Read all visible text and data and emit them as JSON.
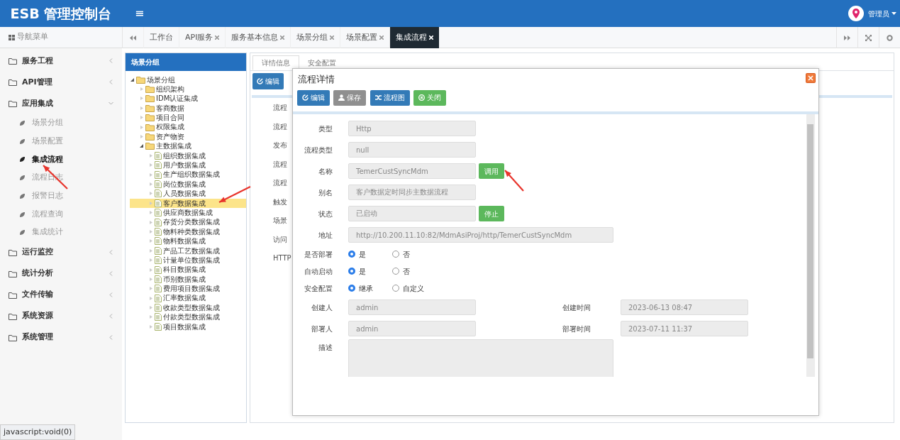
{
  "app": {
    "title": "ESB 管理控制台",
    "menu_toggle": "≡",
    "user": "管理员"
  },
  "nav_label": "导航菜单",
  "tabs": [
    {
      "label": "工作台",
      "closable": false,
      "selected": false
    },
    {
      "label": "API服务",
      "closable": true,
      "selected": false
    },
    {
      "label": "服务基本信息",
      "closable": true,
      "selected": false
    },
    {
      "label": "场景分组",
      "closable": true,
      "selected": false
    },
    {
      "label": "场景配置",
      "closable": true,
      "selected": false
    },
    {
      "label": "集成流程",
      "closable": true,
      "selected": true
    }
  ],
  "sidebar": {
    "items": [
      {
        "label": "服务工程",
        "expanded": false
      },
      {
        "label": "API管理",
        "expanded": false
      },
      {
        "label": "应用集成",
        "expanded": true,
        "children": [
          {
            "label": "场景分组",
            "selected": false
          },
          {
            "label": "场景配置",
            "selected": false
          },
          {
            "label": "集成流程",
            "selected": true
          },
          {
            "label": "流程日志",
            "selected": false
          },
          {
            "label": "报警日志",
            "selected": false
          },
          {
            "label": "流程查询",
            "selected": false
          },
          {
            "label": "集成统计",
            "selected": false
          }
        ]
      },
      {
        "label": "运行监控",
        "expanded": false
      },
      {
        "label": "统计分析",
        "expanded": false
      },
      {
        "label": "文件传输",
        "expanded": false
      },
      {
        "label": "系统资源",
        "expanded": false
      },
      {
        "label": "系统管理",
        "expanded": false
      }
    ]
  },
  "tree": {
    "title": "场景分组",
    "items": [
      {
        "label": "场景分组",
        "kind": "folder",
        "expanded": true,
        "selected": false,
        "children": [
          {
            "label": "组织架构",
            "kind": "folder",
            "expanded": false,
            "selected": false
          },
          {
            "label": "IDM认证集成",
            "kind": "folder",
            "expanded": false,
            "selected": false
          },
          {
            "label": "客商数据",
            "kind": "folder",
            "expanded": false,
            "selected": false
          },
          {
            "label": "项目合同",
            "kind": "folder",
            "expanded": false,
            "selected": false
          },
          {
            "label": "权限集成",
            "kind": "folder",
            "expanded": false,
            "selected": false
          },
          {
            "label": "资产物资",
            "kind": "folder",
            "expanded": false,
            "selected": false
          },
          {
            "label": "主数据集成",
            "kind": "folder",
            "expanded": true,
            "selected": false,
            "children": [
              {
                "label": "组织数据集成",
                "kind": "file",
                "expanded": false,
                "selected": false
              },
              {
                "label": "用户数据集成",
                "kind": "file",
                "expanded": false,
                "selected": false
              },
              {
                "label": "生产组织数据集成",
                "kind": "file",
                "expanded": false,
                "selected": false
              },
              {
                "label": "岗位数据集成",
                "kind": "file",
                "expanded": false,
                "selected": false
              },
              {
                "label": "人员数据集成",
                "kind": "file",
                "expanded": false,
                "selected": false
              },
              {
                "label": "客户数据集成",
                "kind": "file",
                "expanded": false,
                "selected": true
              },
              {
                "label": "供应商数据集成",
                "kind": "file",
                "expanded": false,
                "selected": false
              },
              {
                "label": "存货分类数据集成",
                "kind": "file",
                "expanded": false,
                "selected": false
              },
              {
                "label": "物料种类数据集成",
                "kind": "file",
                "expanded": false,
                "selected": false
              },
              {
                "label": "物料数据集成",
                "kind": "file",
                "expanded": false,
                "selected": false
              },
              {
                "label": "产品工艺数据集成",
                "kind": "file",
                "expanded": false,
                "selected": false
              },
              {
                "label": "计量单位数据集成",
                "kind": "file",
                "expanded": false,
                "selected": false
              },
              {
                "label": "科目数据集成",
                "kind": "file",
                "expanded": false,
                "selected": false
              },
              {
                "label": "币别数据集成",
                "kind": "file",
                "expanded": false,
                "selected": false
              },
              {
                "label": "费用项目数据集成",
                "kind": "file",
                "expanded": false,
                "selected": false
              },
              {
                "label": "汇率数据集成",
                "kind": "file",
                "expanded": false,
                "selected": false
              },
              {
                "label": "收款类型数据集成",
                "kind": "file",
                "expanded": false,
                "selected": false
              },
              {
                "label": "付款类型数据集成",
                "kind": "file",
                "expanded": false,
                "selected": false
              },
              {
                "label": "项目数据集成",
                "kind": "file",
                "expanded": false,
                "selected": false
              }
            ]
          }
        ]
      }
    ]
  },
  "detail_panel": {
    "tabs": [
      {
        "label": "详情信息",
        "selected": true
      },
      {
        "label": "安全配置",
        "selected": false
      }
    ],
    "buttons": [
      "编辑"
    ],
    "field_labels": [
      "流程",
      "流程",
      "发布",
      "流程",
      "流程",
      "触发",
      "场景",
      "访问",
      "HTTP"
    ]
  },
  "dialog": {
    "title": "流程详情",
    "buttons": [
      {
        "label": "编辑",
        "kind": "edit",
        "disabled": false
      },
      {
        "label": "保存",
        "kind": "save",
        "disabled": true
      },
      {
        "label": "流程图",
        "kind": "diagram",
        "disabled": false
      },
      {
        "label": "关闭",
        "kind": "close",
        "disabled": false
      }
    ],
    "fields": [
      {
        "kind": "text",
        "label": "类型",
        "value": "Http"
      },
      {
        "kind": "text",
        "label": "流程类型",
        "value": "null"
      },
      {
        "kind": "text",
        "label": "名称",
        "value": "TemerCustSyncMdm",
        "action": "调用"
      },
      {
        "kind": "text",
        "label": "别名",
        "value": "客户数据定时同步主数据流程"
      },
      {
        "kind": "text",
        "label": "状态",
        "value": "已启动",
        "action": "停止"
      },
      {
        "kind": "wide",
        "label": "地址",
        "value": "http://10.200.11.10:82/MdmAsiProj/http/TemerCustSyncMdm"
      },
      {
        "kind": "radio",
        "label": "是否部署",
        "options": [
          {
            "label": "是",
            "selected": true
          },
          {
            "label": "否",
            "selected": false
          }
        ]
      },
      {
        "kind": "radio",
        "label": "自动启动",
        "options": [
          {
            "label": "是",
            "selected": true
          },
          {
            "label": "否",
            "selected": false
          }
        ]
      },
      {
        "kind": "radio",
        "label": "安全配置",
        "options": [
          {
            "label": "继承",
            "selected": true
          },
          {
            "label": "自定义",
            "selected": false
          }
        ]
      },
      {
        "kind": "pair",
        "label": "创建人",
        "value": "admin",
        "label2": "创建时间",
        "value2": "2023-06-13 08:47"
      },
      {
        "kind": "pair",
        "label": "部署人",
        "value": "admin",
        "label2": "部署时间",
        "value2": "2023-07-11 11:37"
      },
      {
        "kind": "textarea",
        "label": "描述"
      }
    ]
  },
  "status_bar": "javascript:void(0)"
}
